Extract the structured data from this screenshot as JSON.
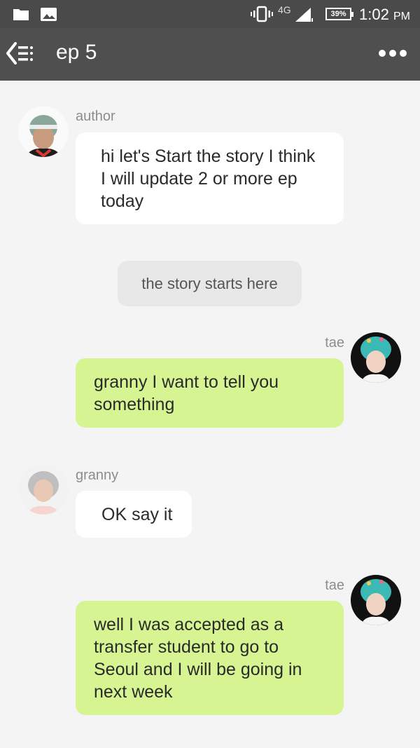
{
  "status_bar": {
    "network": "4G",
    "battery": "39%",
    "time": "1:02",
    "ampm": "PM"
  },
  "header": {
    "title": "ep 5"
  },
  "messages": [
    {
      "sender": "author",
      "text": "hi let's Start the story I think I will update 2 or more ep today"
    },
    {
      "narration": "the story starts here"
    },
    {
      "sender": "tae",
      "text": "granny I want to tell you something"
    },
    {
      "sender": "granny",
      "text": "OK say it"
    },
    {
      "sender": "tae",
      "text": "well I was accepted as a transfer student to go to Seoul and I will be going in next week"
    }
  ],
  "colors": {
    "header_bg": "#4f4f4f",
    "status_bg": "#4a4a4a",
    "sent_bubble": "#d6f592",
    "received_bubble": "#ffffff",
    "chat_bg": "#f4f4f4"
  }
}
